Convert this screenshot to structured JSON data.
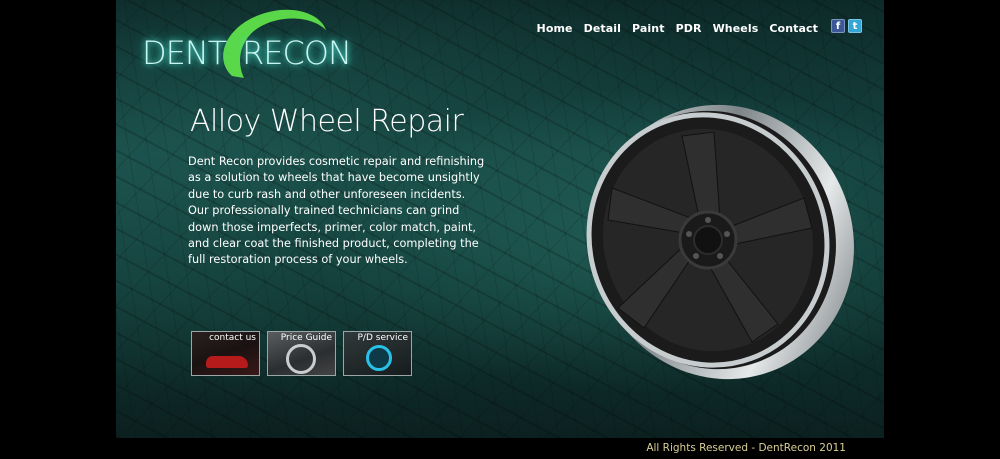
{
  "brand": {
    "word1": "DENT",
    "word2": "RECON",
    "accent_color": "#6fe85a",
    "glow_color": "#5ff3e0"
  },
  "nav": {
    "items": [
      "Home",
      "Detail",
      "Paint",
      "PDR",
      "Wheels",
      "Contact"
    ]
  },
  "social": {
    "facebook_glyph": "f",
    "twitter_glyph": "t",
    "facebook_color": "#3b5998",
    "twitter_color": "#33a6d6"
  },
  "main": {
    "title": "Alloy Wheel Repair",
    "description": "Dent Recon provides cosmetic repair and refinishing as a solution to wheels that have become unsightly due to curb rash and other unforeseen incidents. Our professionally trained technicians can grind down those imperfects, primer, color match, paint, and clear coat the finished product, completing the full restoration process of your wheels."
  },
  "thumbs": [
    {
      "label": "contact us",
      "icon": "car-photo"
    },
    {
      "label": "Price Guide",
      "icon": "rim-photo"
    },
    {
      "label": "P/D service",
      "icon": "car-service-icon"
    }
  ],
  "footer": {
    "text": "All Rights Reserved - DentRecon 2011"
  }
}
